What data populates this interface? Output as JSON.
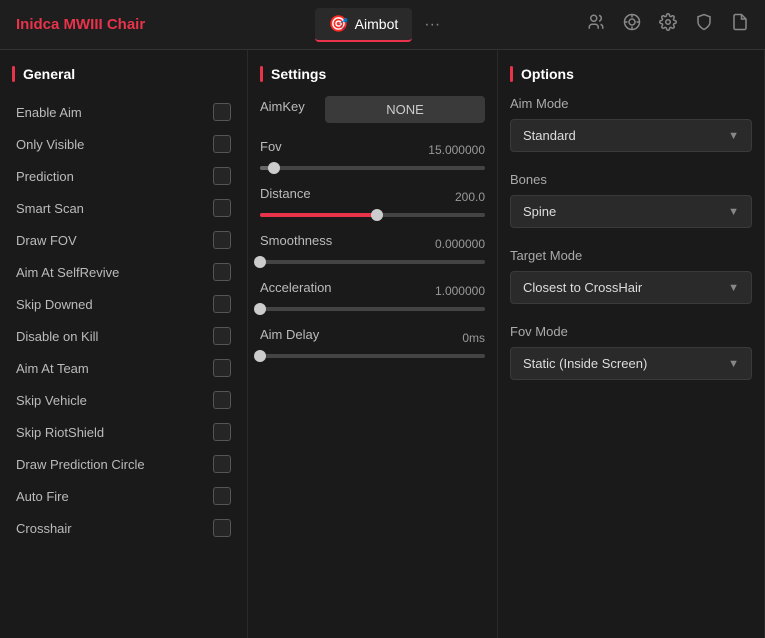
{
  "header": {
    "title": "Inidca MWIII Chair",
    "tabs": [
      {
        "id": "aimbot",
        "label": "Aimbot",
        "icon": "🎯",
        "active": true
      },
      {
        "id": "more",
        "label": "...",
        "active": false
      }
    ],
    "icons": [
      "👥",
      "🎯",
      "⚙️",
      "🛡️",
      "📄"
    ]
  },
  "panels": {
    "general": {
      "title": "General",
      "items": [
        {
          "label": "Enable Aim",
          "checked": false
        },
        {
          "label": "Only Visible",
          "checked": false
        },
        {
          "label": "Prediction",
          "checked": false
        },
        {
          "label": "Smart Scan",
          "checked": false
        },
        {
          "label": "Draw FOV",
          "checked": false
        },
        {
          "label": "Aim At SelfRevive",
          "checked": false
        },
        {
          "label": "Skip Downed",
          "checked": false
        },
        {
          "label": "Disable on Kill",
          "checked": false
        },
        {
          "label": "Aim At Team",
          "checked": false
        },
        {
          "label": "Skip Vehicle",
          "checked": false
        },
        {
          "label": "Skip RiotShield",
          "checked": false
        },
        {
          "label": "Draw Prediction Circle",
          "checked": false
        },
        {
          "label": "Auto Fire",
          "checked": false
        },
        {
          "label": "Crosshair",
          "checked": false
        }
      ]
    },
    "settings": {
      "title": "Settings",
      "aimkey_label": "AimKey",
      "aimkey_value": "NONE",
      "sliders": [
        {
          "id": "fov",
          "label": "Fov",
          "value": "15.000000",
          "fill_pct": 6,
          "type": "gray"
        },
        {
          "id": "distance",
          "label": "Distance",
          "value": "200.0",
          "fill_pct": 52,
          "type": "red"
        },
        {
          "id": "smoothness",
          "label": "Smoothness",
          "value": "0.000000",
          "fill_pct": 0,
          "type": "gray"
        },
        {
          "id": "acceleration",
          "label": "Acceleration",
          "value": "1.000000",
          "fill_pct": 0,
          "type": "gray"
        },
        {
          "id": "aim_delay",
          "label": "Aim Delay",
          "value": "0ms",
          "fill_pct": 0,
          "type": "gray"
        }
      ]
    },
    "options": {
      "title": "Options",
      "dropdowns": [
        {
          "id": "aim_mode",
          "label": "Aim Mode",
          "value": "Standard"
        },
        {
          "id": "bones",
          "label": "Bones",
          "value": "Spine"
        },
        {
          "id": "target_mode",
          "label": "Target Mode",
          "value": "Closest to CrossHair"
        },
        {
          "id": "fov_mode",
          "label": "Fov Mode",
          "value": "Static (Inside Screen)"
        }
      ]
    }
  }
}
